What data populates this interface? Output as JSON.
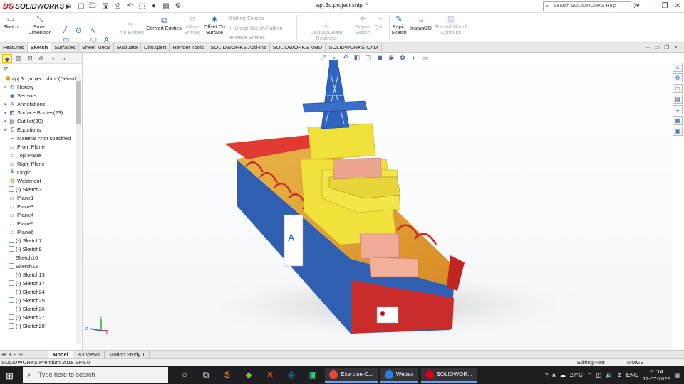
{
  "app": {
    "brand": "SOLIDWORKS",
    "doc_title": "apj.3d.project ship. *"
  },
  "help": {
    "placeholder": "Search SOLIDWORKS Help"
  },
  "command_manager": {
    "sketch": "Sketch",
    "smart_dimension": "Smart Dimension",
    "trim_entities": "Trim Entities",
    "convert_entities": "Convert Entities",
    "offset_entities": "Offset Entities",
    "offset_on_surface": "Offset On Surface",
    "mirror_entities": "Mirror Entities",
    "linear_sketch_pattern": "Linear Sketch Pattern",
    "move_entities": "Move Entities",
    "display_delete_relations": "Display/Delete Relations",
    "repair_sketch": "Repair Sketch",
    "quick_snaps": "Qui...",
    "rapid_sketch": "Rapid Sketch",
    "instant2d": "Instant2D",
    "shaded_sketch_contours": "Shaded Sketch Contours"
  },
  "tabs": [
    "Features",
    "Sketch",
    "Surfaces",
    "Sheet Metal",
    "Evaluate",
    "DimXpert",
    "Render Tools",
    "SOLIDWORKS Add-Ins",
    "SOLIDWORKS MBD",
    "SOLIDWORKS CAM"
  ],
  "active_tab": "Sketch",
  "tree": [
    {
      "label": "apj.3d.project ship.  (Defaul",
      "icon": "part-icon",
      "expand": ""
    },
    {
      "label": "History",
      "icon": "history-icon",
      "expand": "▸"
    },
    {
      "label": "Sensors",
      "icon": "sensors-icon",
      "expand": ""
    },
    {
      "label": "Annotations",
      "icon": "annotations-icon",
      "expand": "▸"
    },
    {
      "label": "Surface Bodies(23)",
      "icon": "surface-bodies-icon",
      "expand": "▸"
    },
    {
      "label": "Cut list(20)",
      "icon": "cut-list-icon",
      "expand": "▸"
    },
    {
      "label": "Equations",
      "icon": "equations-icon",
      "expand": "▸"
    },
    {
      "label": "Material <not specified",
      "icon": "material-icon",
      "expand": ""
    },
    {
      "label": "Front Plane",
      "icon": "plane-icon",
      "expand": ""
    },
    {
      "label": "Top Plane",
      "icon": "plane-icon",
      "expand": ""
    },
    {
      "label": "Right Plane",
      "icon": "plane-icon",
      "expand": ""
    },
    {
      "label": "Origin",
      "icon": "origin-icon",
      "expand": ""
    },
    {
      "label": "Weldment",
      "icon": "weldment-icon",
      "expand": ""
    },
    {
      "label": "(-) Sketch3",
      "icon": "sketch-icon",
      "expand": ""
    },
    {
      "label": "Plane1",
      "icon": "plane-icon",
      "expand": ""
    },
    {
      "label": "Plane3",
      "icon": "plane-icon",
      "expand": ""
    },
    {
      "label": "Plane4",
      "icon": "plane-icon",
      "expand": ""
    },
    {
      "label": "Plane5",
      "icon": "plane-icon",
      "expand": ""
    },
    {
      "label": "Plane6",
      "icon": "plane-icon",
      "expand": ""
    },
    {
      "label": "(-) Sketch7",
      "icon": "sketch-icon",
      "expand": ""
    },
    {
      "label": "(-) Sketch8",
      "icon": "sketch-icon",
      "expand": ""
    },
    {
      "label": "Sketch10",
      "icon": "sketch-icon",
      "expand": ""
    },
    {
      "label": "Sketch12",
      "icon": "sketch-icon",
      "expand": ""
    },
    {
      "label": "(-) Sketch13",
      "icon": "sketch-icon",
      "expand": ""
    },
    {
      "label": "(-) Sketch17",
      "icon": "sketch-icon",
      "expand": ""
    },
    {
      "label": "(-) Sketch24",
      "icon": "sketch-icon",
      "expand": ""
    },
    {
      "label": "(-) Sketch25",
      "icon": "sketch-icon",
      "expand": ""
    },
    {
      "label": "(-) Sketch26",
      "icon": "sketch-icon",
      "expand": ""
    },
    {
      "label": "(-) Sketch27",
      "icon": "sketch-icon",
      "expand": ""
    },
    {
      "label": "(-) Sketch28",
      "icon": "sketch-icon",
      "expand": ""
    }
  ],
  "bottom_tabs": [
    "Model",
    "3D Views",
    "Motion Study 1"
  ],
  "status": {
    "product": "SOLIDWORKS Premium 2018 SP5.0",
    "mode": "Editing Part",
    "units": "MMGS"
  },
  "taskbar": {
    "search_placeholder": "Type here to search",
    "apps": [
      {
        "label": "Exercise-C...",
        "color": "#e8453c"
      },
      {
        "label": "Webex",
        "color": "#2a7be4"
      },
      {
        "label": "SOLIDWOR...",
        "color": "#d0021b"
      }
    ],
    "weather": "27°C",
    "lang": "ENG",
    "time": "20:14",
    "date": "12-07-2022"
  },
  "colors": {
    "hull_blue": "#2f5fb0",
    "hull_red": "#d9312b",
    "deck_yellow": "#f0e23a",
    "accent": "#2a5ea8"
  }
}
